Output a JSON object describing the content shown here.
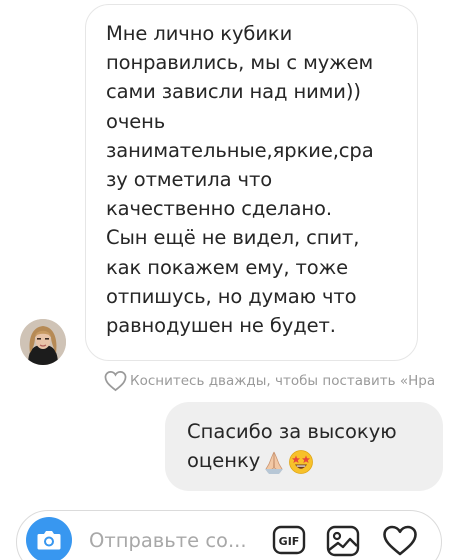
{
  "conversation": {
    "incoming_message": {
      "text": "Мне лично кубики\nпонравились, мы с мужем\nсами зависли над ними))\nочень\nзанимательные,яркие,сра\nзу отметила что\nкачественно сделано.\nСын ещё не видел, спит,\nкак покажем ему, тоже\nотпишусь, но думаю что\nравнодушен не будет."
    },
    "like_hint": "Коснитесь дважды, чтобы поставить «Нра",
    "outgoing_message": {
      "text": "Спасибо за высокую оценку",
      "emojis": [
        "folded-hands-emoji",
        "star-struck-emoji"
      ]
    }
  },
  "composer": {
    "placeholder": "Отправьте со...",
    "gif_label": "GIF",
    "icons": [
      "camera-icon",
      "gif-icon",
      "gallery-icon",
      "heart-icon"
    ]
  },
  "colors": {
    "accent": "#3897f0",
    "bubble_outgoing": "#efefef",
    "text": "#262626",
    "hint": "#9a9a9a"
  }
}
